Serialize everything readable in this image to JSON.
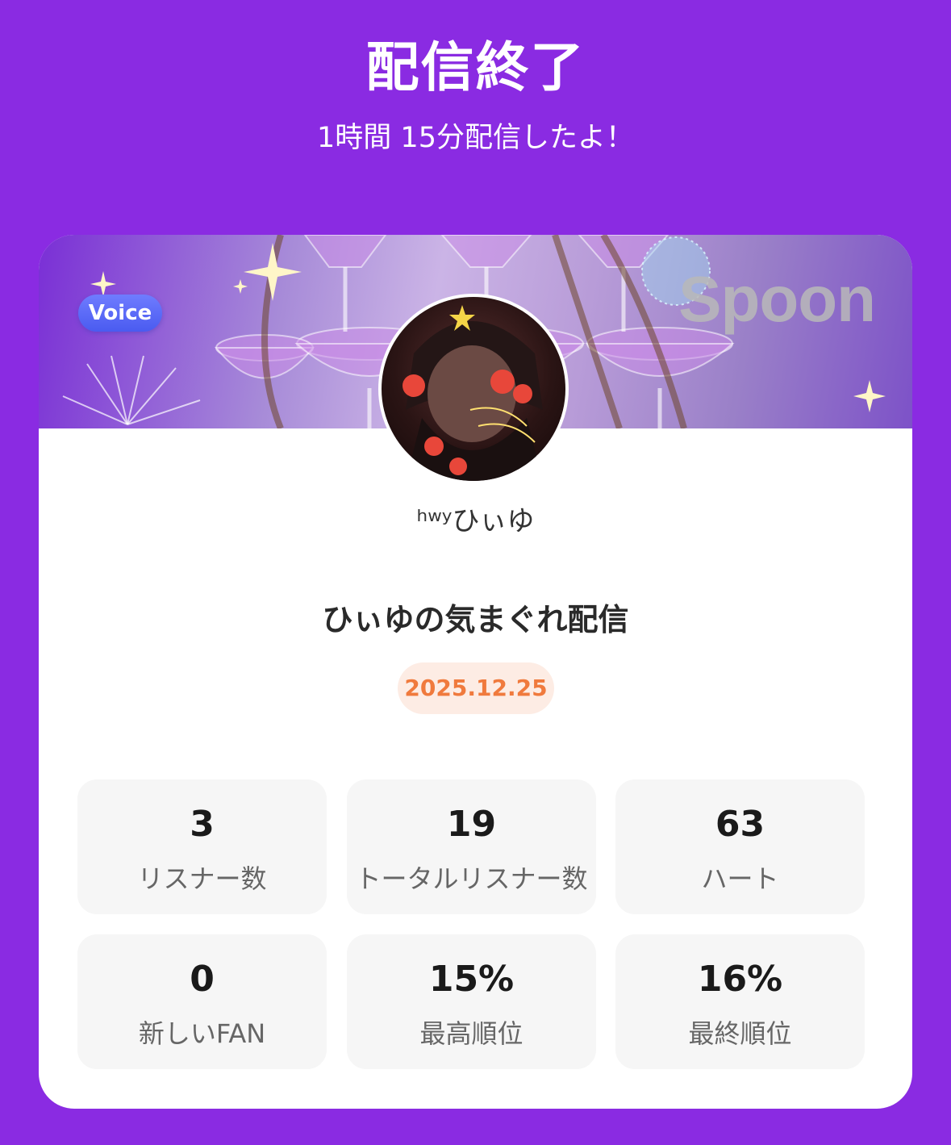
{
  "header": {
    "title": "配信終了",
    "subtitle": "1時間 15分配信したよ！"
  },
  "card": {
    "badge": "Voice",
    "logo": "Spoon",
    "username": "ʰʷʸひぃゆ",
    "stream_title": "ひぃゆの気まぐれ配信",
    "date": "2025.12.25"
  },
  "stats": [
    {
      "value": "3",
      "label": "リスナー数"
    },
    {
      "value": "19",
      "label": "トータルリスナー数"
    },
    {
      "value": "63",
      "label": "ハート"
    },
    {
      "value": "0",
      "label": "新しいFAN"
    },
    {
      "value": "15%",
      "label": "最高順位"
    },
    {
      "value": "16%",
      "label": "最終順位"
    }
  ],
  "colors": {
    "background": "#8a2be2",
    "badge": "#4a5bf0",
    "date_text": "#f07a3d",
    "date_bg": "#fdece4"
  }
}
